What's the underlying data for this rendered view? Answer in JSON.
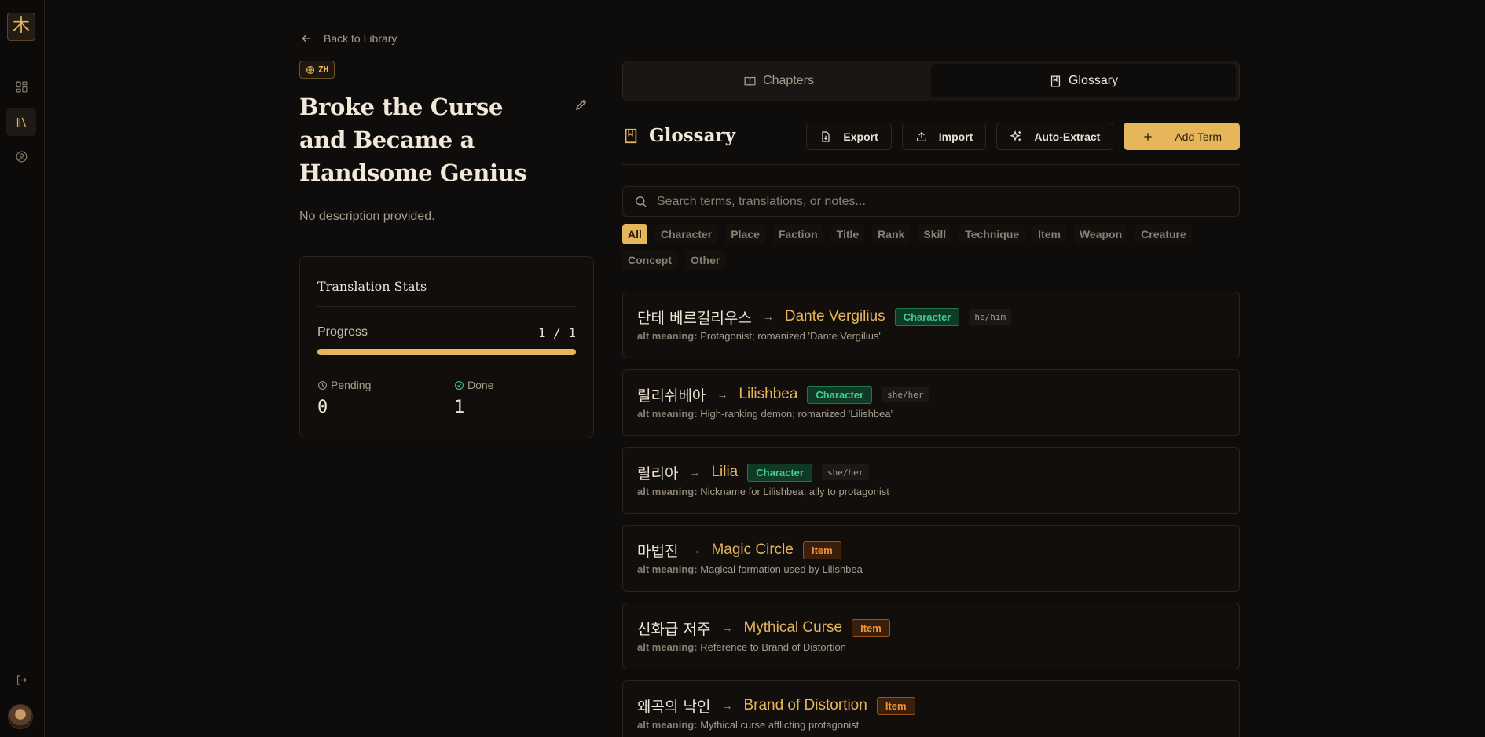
{
  "sidebar": {
    "logo": "木"
  },
  "book": {
    "back_label": "Back to Library",
    "lang": "ZH",
    "title": "Broke the Curse and Became a Handsome Genius",
    "description": "No description provided."
  },
  "stats": {
    "title": "Translation Stats",
    "progress_label": "Progress",
    "progress_value": "1 / 1",
    "progress_fraction": 1.0,
    "pending_label": "Pending",
    "pending_value": "0",
    "done_label": "Done",
    "done_value": "1"
  },
  "tabs": [
    {
      "label": "Chapters",
      "active": false
    },
    {
      "label": "Glossary",
      "active": true
    }
  ],
  "glossary": {
    "title": "Glossary",
    "actions": {
      "export": "Export",
      "import": "Import",
      "auto_extract": "Auto-Extract",
      "add_term": "Add Term"
    },
    "search_placeholder": "Search terms, translations, or notes...",
    "filters": [
      "All",
      "Character",
      "Place",
      "Faction",
      "Title",
      "Rank",
      "Skill",
      "Technique",
      "Item",
      "Weapon",
      "Creature",
      "Concept",
      "Other"
    ],
    "active_filter": "All",
    "alt_label": "alt meaning:",
    "entries": [
      {
        "source": "단테 베르길리우스",
        "target": "Dante Vergilius",
        "type": "Character",
        "pronoun": "he/him",
        "note": "Protagonist; romanized 'Dante Vergilius'"
      },
      {
        "source": "릴리쉬베아",
        "target": "Lilishbea",
        "type": "Character",
        "pronoun": "she/her",
        "note": "High-ranking demon; romanized 'Lilishbea'"
      },
      {
        "source": "릴리아",
        "target": "Lilia",
        "type": "Character",
        "pronoun": "she/her",
        "note": "Nickname for Lilishbea; ally to protagonist"
      },
      {
        "source": "마법진",
        "target": "Magic Circle",
        "type": "Item",
        "pronoun": "",
        "note": "Magical formation used by Lilishbea"
      },
      {
        "source": "신화급 저주",
        "target": "Mythical Curse",
        "type": "Item",
        "pronoun": "",
        "note": "Reference to Brand of Distortion"
      },
      {
        "source": "왜곡의 낙인",
        "target": "Brand of Distortion",
        "type": "Item",
        "pronoun": "",
        "note": "Mythical curse afflicting protagonist"
      }
    ]
  },
  "colors": {
    "accent": "#e7b55a",
    "character_tag": "#3cd08a",
    "item_tag": "#f2913a",
    "background": "#0f0d0b"
  }
}
